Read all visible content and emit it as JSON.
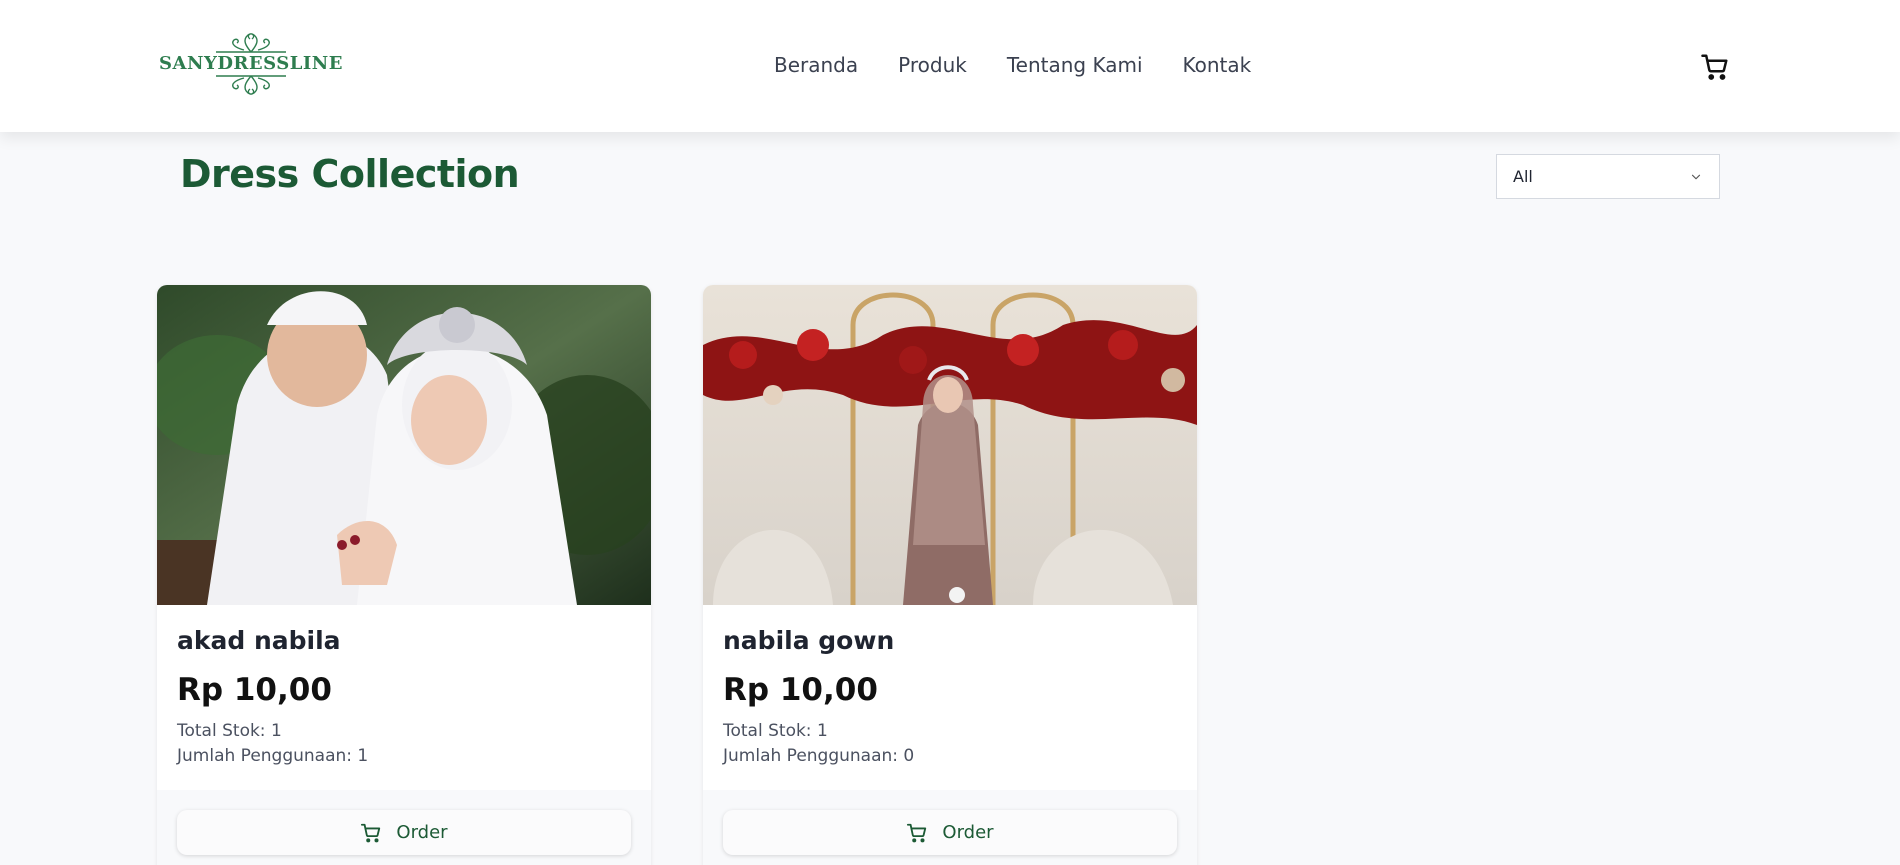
{
  "brand": {
    "name": "SANYDRESSLINE"
  },
  "nav": {
    "items": [
      {
        "label": "Beranda"
      },
      {
        "label": "Produk"
      },
      {
        "label": "Tentang Kami"
      },
      {
        "label": "Kontak"
      }
    ]
  },
  "page": {
    "title": "Dress Collection"
  },
  "filter": {
    "selected": "All"
  },
  "products": [
    {
      "name": "akad nabila",
      "price": "Rp 10,00",
      "stock": "Total Stok: 1",
      "usage": "Jumlah Penggunaan: 1",
      "order_label": "Order"
    },
    {
      "name": "nabila gown",
      "price": "Rp 10,00",
      "stock": "Total Stok: 1",
      "usage": "Jumlah Penggunaan: 0",
      "order_label": "Order"
    }
  ],
  "colors": {
    "brand_green": "#1c5a35",
    "logo_green": "#2e7d4f",
    "page_bg": "#f8f9fb"
  },
  "icons": {
    "cart": "cart-icon",
    "chevron": "chevron-down-icon"
  }
}
